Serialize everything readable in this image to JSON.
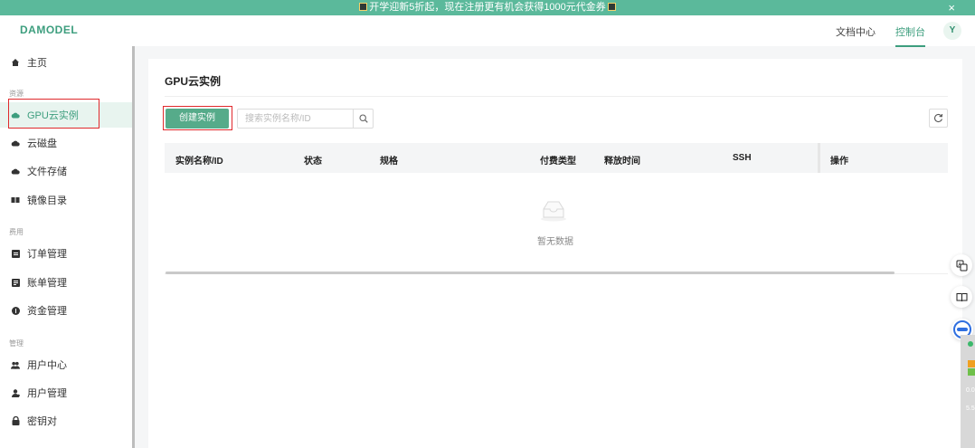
{
  "banner": {
    "text": "开学迎新5折起，现在注册更有机会获得1000元代金券",
    "close": "×"
  },
  "header": {
    "logo": "DAMODEL",
    "links": {
      "docs": "文档中心",
      "console": "控制台"
    },
    "avatar": "Y"
  },
  "sidebar": {
    "home": "主页",
    "groups": {
      "resources": "资源",
      "billing": "费用",
      "manage": "管理"
    },
    "items": {
      "gpu_instances": "GPU云实例",
      "cloud_disk": "云磁盘",
      "file_storage": "文件存储",
      "image_catalog": "镜像目录",
      "orders": "订单管理",
      "bills": "账单管理",
      "funds": "资金管理",
      "user_center": "用户中心",
      "user_manage": "用户管理",
      "key_pairs": "密钥对"
    }
  },
  "main": {
    "title": "GPU云实例",
    "create_button": "创建实例",
    "search": {
      "placeholder": "搜索实例名称/ID",
      "value": ""
    },
    "table": {
      "columns": {
        "name": "实例名称/ID",
        "status": "状态",
        "spec": "规格",
        "pay_type": "付费类型",
        "release": "释放时间",
        "ssh": "SSH",
        "actions": "操作"
      },
      "rows": [],
      "empty_text": "暂无数据"
    }
  },
  "side_panel": {
    "num1": "0.0",
    "num2": "5.5"
  },
  "colors": {
    "accent": "#3d9e7e",
    "banner": "#5bb99b",
    "button": "#56ab8a",
    "highlight": "#e0292c"
  }
}
